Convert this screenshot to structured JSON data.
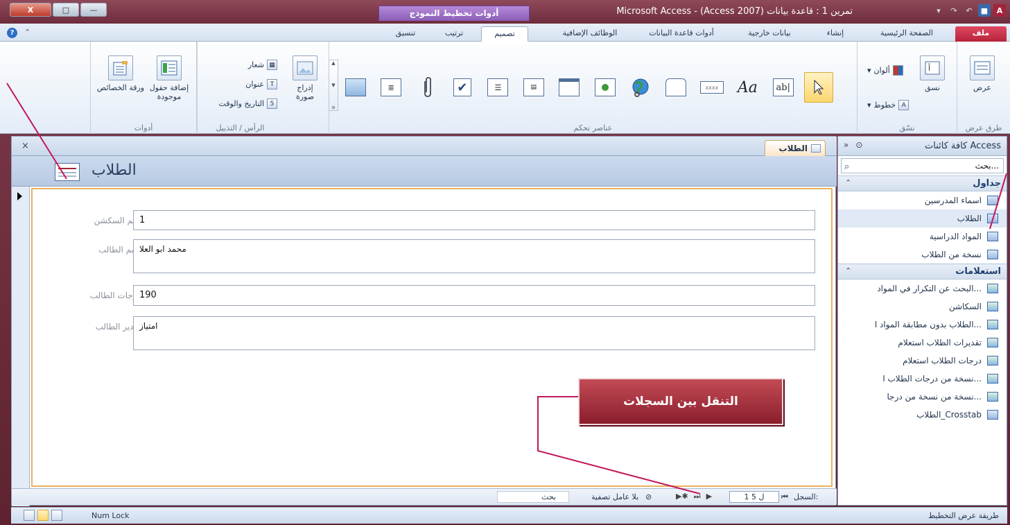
{
  "window": {
    "title": "تمرين 1 : قاعدة بيانات (Access 2007) - Microsoft Access",
    "context_tab_header": "أدوات تخطيط النموذج",
    "controls": {
      "close": "X",
      "maximize": "□",
      "minimize": "—"
    },
    "qat_icons": [
      "access-logo-icon",
      "save-icon",
      "undo-icon",
      "redo-icon",
      "customize-icon"
    ],
    "access_letter": "A"
  },
  "tabs": [
    {
      "id": "file",
      "label": "ملف"
    },
    {
      "id": "home",
      "label": "الصفحة الرئيسية"
    },
    {
      "id": "create",
      "label": "إنشاء"
    },
    {
      "id": "external",
      "label": "بيانات خارجية"
    },
    {
      "id": "dbtools",
      "label": "أدوات قاعدة البيانات"
    },
    {
      "id": "addins",
      "label": "الوظائف الإضافية"
    },
    {
      "id": "design",
      "label": "تصميم"
    },
    {
      "id": "arrange",
      "label": "ترتيب"
    },
    {
      "id": "format",
      "label": "تنسيق"
    }
  ],
  "ribbon": {
    "views_group": {
      "label": "طرق عرض",
      "view_button": "عرض"
    },
    "themes_group": {
      "label": "نسّق",
      "themes_button": "نسق",
      "colors": "ألوان",
      "fonts": "خطوط"
    },
    "controls_group": {
      "label": "عناصر تحكم"
    },
    "insert_image": "إدراج صورة",
    "header_footer_group": {
      "label": "الرأس / التذييل",
      "logo": "شعار",
      "title": "عنوان",
      "date_time": "التاريخ والوقت"
    },
    "tools_group": {
      "label": "أدوات",
      "add_fields": "إضافة حقول موجودة",
      "property_sheet": "ورقة الخصائص"
    }
  },
  "document": {
    "tab_label": "الطلاب",
    "close_glyph": "×",
    "form_title": "الطلاب",
    "fields": [
      {
        "label": "رقم السكشن",
        "value": "1"
      },
      {
        "label": "اسم الطالب",
        "value": "محمد ابو العلا"
      },
      {
        "label": "درجات الطالب",
        "value": "190"
      },
      {
        "label": "تقدير الطالب",
        "value": "امتياز"
      }
    ],
    "navigation": {
      "record_label": "السجل:",
      "counter": "1 ل 5",
      "filter_text": "بلا عامل تصفية",
      "search_label": "بحث"
    }
  },
  "navpane": {
    "title": "كافة كائنات Access",
    "search_placeholder": "بحث...",
    "groups": [
      {
        "title": "جداول",
        "items": [
          "اسماء المدرسين",
          "الطلاب",
          "المواد الدراسية",
          "نسخة من الطلاب"
        ]
      },
      {
        "title": "استعلامات",
        "items": [
          "البحث عن التكرار في المواد...",
          "السكاشن",
          "الطلاب بدون مطابقة المواد ا...",
          "تقديرات الطلاب استعلام",
          "درجات الطلاب استعلام",
          "نسخة من درجات الطلاب ا...",
          "نسخة من نسخة من درجا...",
          "الطلاب_Crosstab"
        ]
      }
    ]
  },
  "statusbar": {
    "mode": "طريقة عرض التخطيط",
    "numlock": "Num Lock"
  },
  "callout": {
    "text": "التنقل بين السجلات"
  },
  "colors": {
    "accent": "#a3243a",
    "callout_fill": "#a42e3a",
    "selection_border": "#e8b25e"
  }
}
